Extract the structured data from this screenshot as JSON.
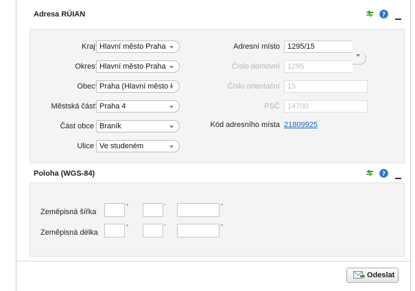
{
  "address_panel": {
    "title": "Adresa RÚIAN",
    "fields": {
      "kraj": {
        "label": "Kraj",
        "required": "*",
        "value": "Hlavní město Praha"
      },
      "okres": {
        "label": "Okres",
        "required": "*",
        "value": "Hlavní město Praha"
      },
      "obec": {
        "label": "Obec",
        "required": "*",
        "value": "Praha (Hlavní město I"
      },
      "mestska_cast": {
        "label": "Městská část",
        "required": "*",
        "value": "Praha 4"
      },
      "cast_obce": {
        "label": "Část obce",
        "value": "Braník"
      },
      "ulice": {
        "label": "Ulice",
        "value": "Ve studeném"
      },
      "adresni_misto": {
        "label": "Adresní místo",
        "value": "1295/15"
      },
      "cislo_domovni": {
        "label": "Číslo domovní",
        "value": "1295"
      },
      "cislo_orientacni": {
        "label": "Číslo orientační",
        "value": "15"
      },
      "psc": {
        "label": "PSČ",
        "value": "14700"
      },
      "kod_adresniho_mista": {
        "label": "Kód adresního místa",
        "value": "21809925"
      }
    }
  },
  "position_panel": {
    "title": "Poloha (WGS-84)",
    "latitude": {
      "label": "Zeměpisná šířka",
      "deg_unit": "°",
      "min_unit": "'",
      "sec_unit": "\""
    },
    "longitude": {
      "label": "Zeměpisná délka",
      "deg_unit": "°",
      "min_unit": "'",
      "sec_unit": "\""
    }
  },
  "icons": {
    "refresh": "refresh-icon",
    "help": "help-icon",
    "collapse": "collapse-icon",
    "send": "send-mail-icon"
  },
  "colors": {
    "required": "#dd0000",
    "link": "#1d5fbf",
    "refresh_icon": "#3d9b2f",
    "help_icon": "#2b6fc7"
  },
  "footer": {
    "send_label": "Odeslat"
  }
}
